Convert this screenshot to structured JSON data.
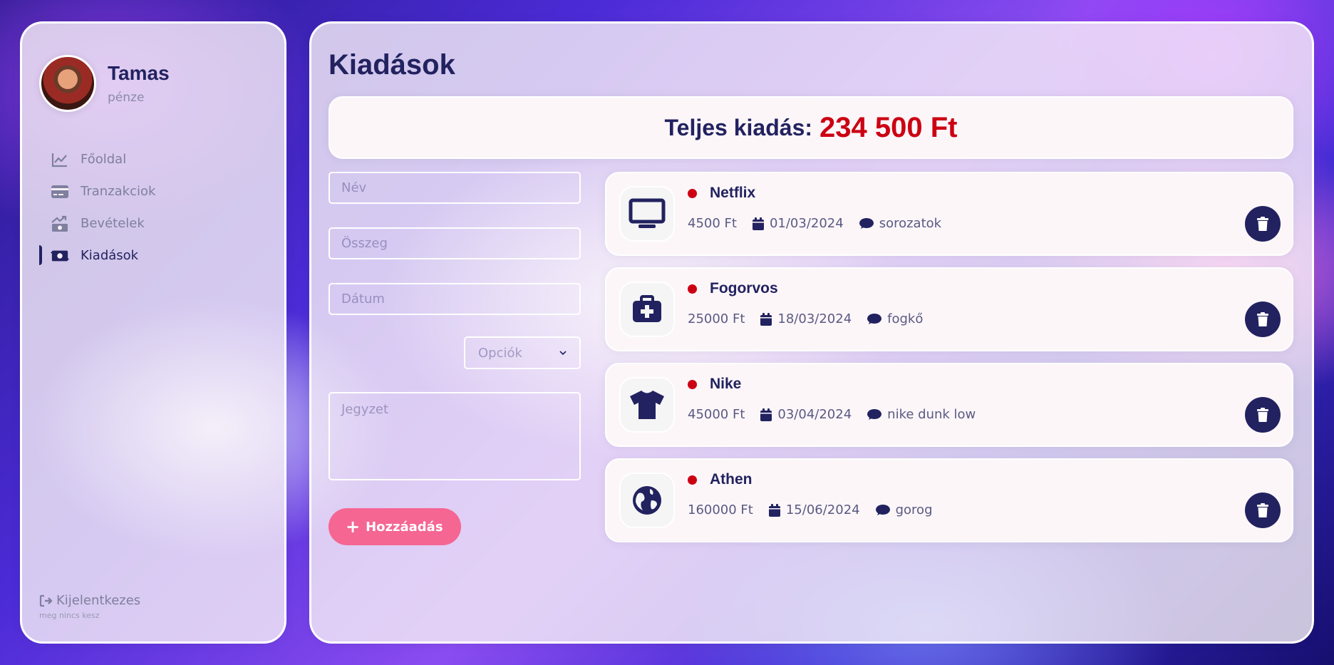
{
  "user": {
    "name": "Tamas",
    "subtitle": "pénze"
  },
  "nav": [
    {
      "label": "Főoldal",
      "icon": "line-chart-icon",
      "active": false
    },
    {
      "label": "Tranzakciok",
      "icon": "credit-card-icon",
      "active": false
    },
    {
      "label": "Bevételek",
      "icon": "money-bill-trend-up-icon",
      "active": false
    },
    {
      "label": "Kiadások",
      "icon": "money-bill-transfer-icon",
      "active": true
    }
  ],
  "logout": {
    "label": "Kijelentkezes",
    "note": "meg nincs kesz"
  },
  "page": {
    "title": "Kiadások"
  },
  "total": {
    "label": "Teljes kiadás:",
    "amount": "234 500 Ft"
  },
  "form": {
    "name_placeholder": "Név",
    "amount_placeholder": "Összeg",
    "date_placeholder": "Dátum",
    "options_selected": "Opciók",
    "note_placeholder": "Jegyzet",
    "add_label": "Hozzáadás"
  },
  "expenses": [
    {
      "title": "Netflix",
      "amount": "4500 Ft",
      "date": "01/03/2024",
      "note": "sorozatok",
      "icon": "tv-icon"
    },
    {
      "title": "Fogorvos",
      "amount": "25000 Ft",
      "date": "18/03/2024",
      "note": "fogkő",
      "icon": "medical-kit-icon"
    },
    {
      "title": "Nike",
      "amount": "45000 Ft",
      "date": "03/04/2024",
      "note": "nike dunk low",
      "icon": "tshirt-icon"
    },
    {
      "title": "Athen",
      "amount": "160000 Ft",
      "date": "15/06/2024",
      "note": "gorog",
      "icon": "globe-icon"
    }
  ],
  "colors": {
    "primary": "#222260",
    "expense_red": "#cc0012",
    "button_pink": "#f56692"
  }
}
